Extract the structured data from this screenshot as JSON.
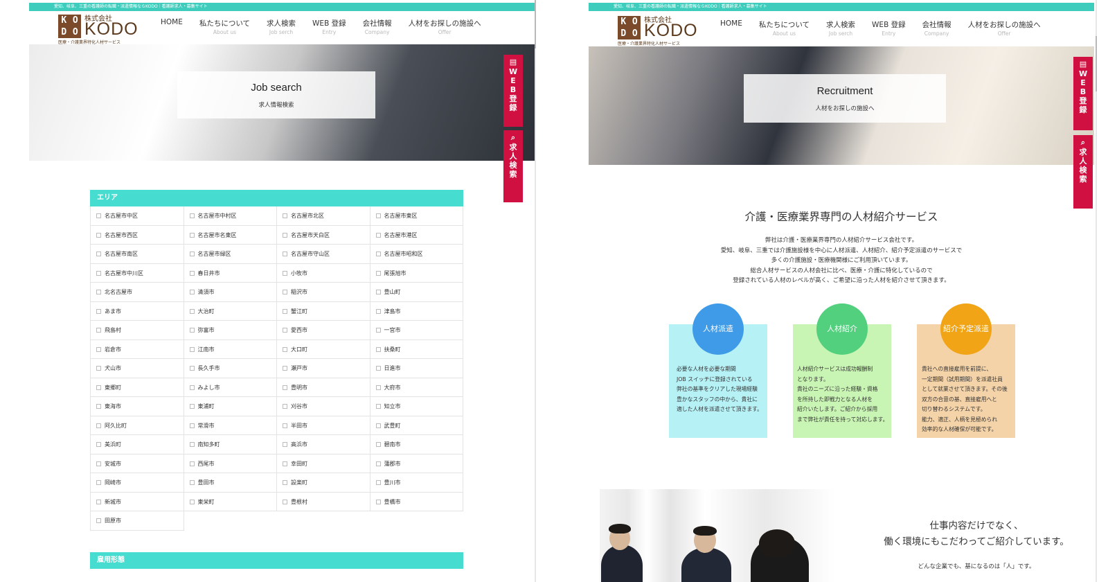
{
  "left": {
    "topbar_text": "愛知、岐阜、三重の看護師の転職・派遣情報ならKODO｜看護師求人・募集サイト",
    "logo": {
      "mark": [
        "K",
        "O",
        "D",
        "O"
      ],
      "company": "株式会社",
      "name": "KODO",
      "tagline": "医療・介護業界特化人材サービス"
    },
    "nav": [
      {
        "jp": "HOME",
        "en": ""
      },
      {
        "jp": "私たちについて",
        "en": "About us"
      },
      {
        "jp": "求人検索",
        "en": "Job serch"
      },
      {
        "jp": "WEB 登録",
        "en": "Entry"
      },
      {
        "jp": "会社情報",
        "en": "Company"
      },
      {
        "jp": "人材をお探しの施設へ",
        "en": "Offer"
      }
    ],
    "hero": {
      "title": "Job search",
      "subtitle": "求人情報検索"
    },
    "side_tabs": {
      "web": "WEB登録",
      "search": "求人検索"
    },
    "area_header": "エリア",
    "areas": [
      "名古屋市中区",
      "名古屋市中村区",
      "名古屋市北区",
      "名古屋市東区",
      "名古屋市西区",
      "名古屋市名東区",
      "名古屋市天白区",
      "名古屋市港区",
      "名古屋市南区",
      "名古屋市緑区",
      "名古屋市守山区",
      "名古屋市昭和区",
      "名古屋市中川区",
      "春日井市",
      "小牧市",
      "尾張旭市",
      "北名古屋市",
      "清須市",
      "稲沢市",
      "豊山町",
      "あま市",
      "大治町",
      "蟹江町",
      "津島市",
      "飛島村",
      "弥富市",
      "愛西市",
      "一宮市",
      "岩倉市",
      "江南市",
      "大口町",
      "扶桑町",
      "犬山市",
      "長久手市",
      "瀬戸市",
      "日進市",
      "東郷町",
      "みよし市",
      "豊明市",
      "大府市",
      "東海市",
      "東浦町",
      "刈谷市",
      "知立市",
      "阿久比町",
      "常滑市",
      "半田市",
      "武豊町",
      "美浜町",
      "南知多町",
      "高浜市",
      "碧南市",
      "安城市",
      "西尾市",
      "幸田町",
      "蒲郡市",
      "岡崎市",
      "豊田市",
      "設楽町",
      "豊川市",
      "新城市",
      "東栄町",
      "豊根村",
      "豊橋市",
      "田原市"
    ],
    "employment_header": "雇用形態"
  },
  "right": {
    "topbar_text": "愛知、岐阜、三重の看護師の転職・派遣情報ならKODO｜看護師求人・募集サイト",
    "logo": {
      "mark": [
        "K",
        "O",
        "D",
        "O"
      ],
      "company": "株式会社",
      "name": "KODO",
      "tagline": "医療・介護業界特化人材サービス"
    },
    "nav": [
      {
        "jp": "HOME",
        "en": ""
      },
      {
        "jp": "私たちについて",
        "en": "About us"
      },
      {
        "jp": "求人検索",
        "en": "Job serch"
      },
      {
        "jp": "WEB 登録",
        "en": "Entry"
      },
      {
        "jp": "会社情報",
        "en": "Company"
      },
      {
        "jp": "人材をお探しの施設へ",
        "en": "Offer"
      }
    ],
    "hero": {
      "title": "Recruitment",
      "subtitle": "人材をお探しの施設へ"
    },
    "side_tabs": {
      "web": "WEB登録",
      "search": "求人検索"
    },
    "service_title": "介護・医療業界専門の人材紹介サービス",
    "intro_lines": [
      "弊社は介護・医療業界専門の人材紹介サービス会社です。",
      "愛知、岐阜、三重では介護施設様を中心に人材派遣、人材紹介、紹介予定派遣のサービスで",
      "多くの介護施設・医療機関様にご利用頂いています。",
      "総合人材サービスの人材会社に比べ、医療・介護に特化しているので",
      "登録されている人材のレベルが高く、ご希望に沿った人材を紹介させて頂きます。"
    ],
    "cards": [
      {
        "title": "人材派遣",
        "lines": [
          "必要な人材を必要な期間",
          "JOB スイッチに登録されている",
          "弊社の基準をクリアした現場経験",
          "豊かなスタッフの中から、貴社に",
          "適した人材を派遣させて頂きます。"
        ]
      },
      {
        "title": "人材紹介",
        "lines": [
          "人材紹介サービスは成功報酬制",
          "となります。",
          "貴社のニーズに沿った経験・資格",
          "を所持した即戦力となる人材を",
          "紹介いたします。ご紹介から採用",
          "まで弊社が責任を持って対応します。"
        ]
      },
      {
        "title": "紹介予定派遣",
        "lines": [
          "貴社への直接雇用を前提に、",
          "一定期間（試用期間）を派遣社員",
          "として就業させて頂きます。その後",
          "双方の合意の基、直接雇用へと",
          "切り替わるシステムです。",
          "能力、適正、人柄を見極められ",
          "効率的な人材確保が可能です。"
        ]
      }
    ],
    "lead_lines": [
      "仕事内容だけでなく、",
      "働く環境にもこだわってご紹介しています。"
    ],
    "lead_small": "どんな企業でも、基になるのは「人」です。"
  },
  "colors": {
    "accent": "#3ecdbd",
    "area_header": "#46ddd0",
    "side_tab": "#d01040",
    "brand_brown": "#5b3a1d",
    "card_blue": "#b6f1f6",
    "card_green": "#c9f5b4",
    "card_orange": "#f4d3a8",
    "circle_blue": "#3f9be8",
    "circle_green": "#52d07e",
    "circle_orange": "#f0a416"
  }
}
